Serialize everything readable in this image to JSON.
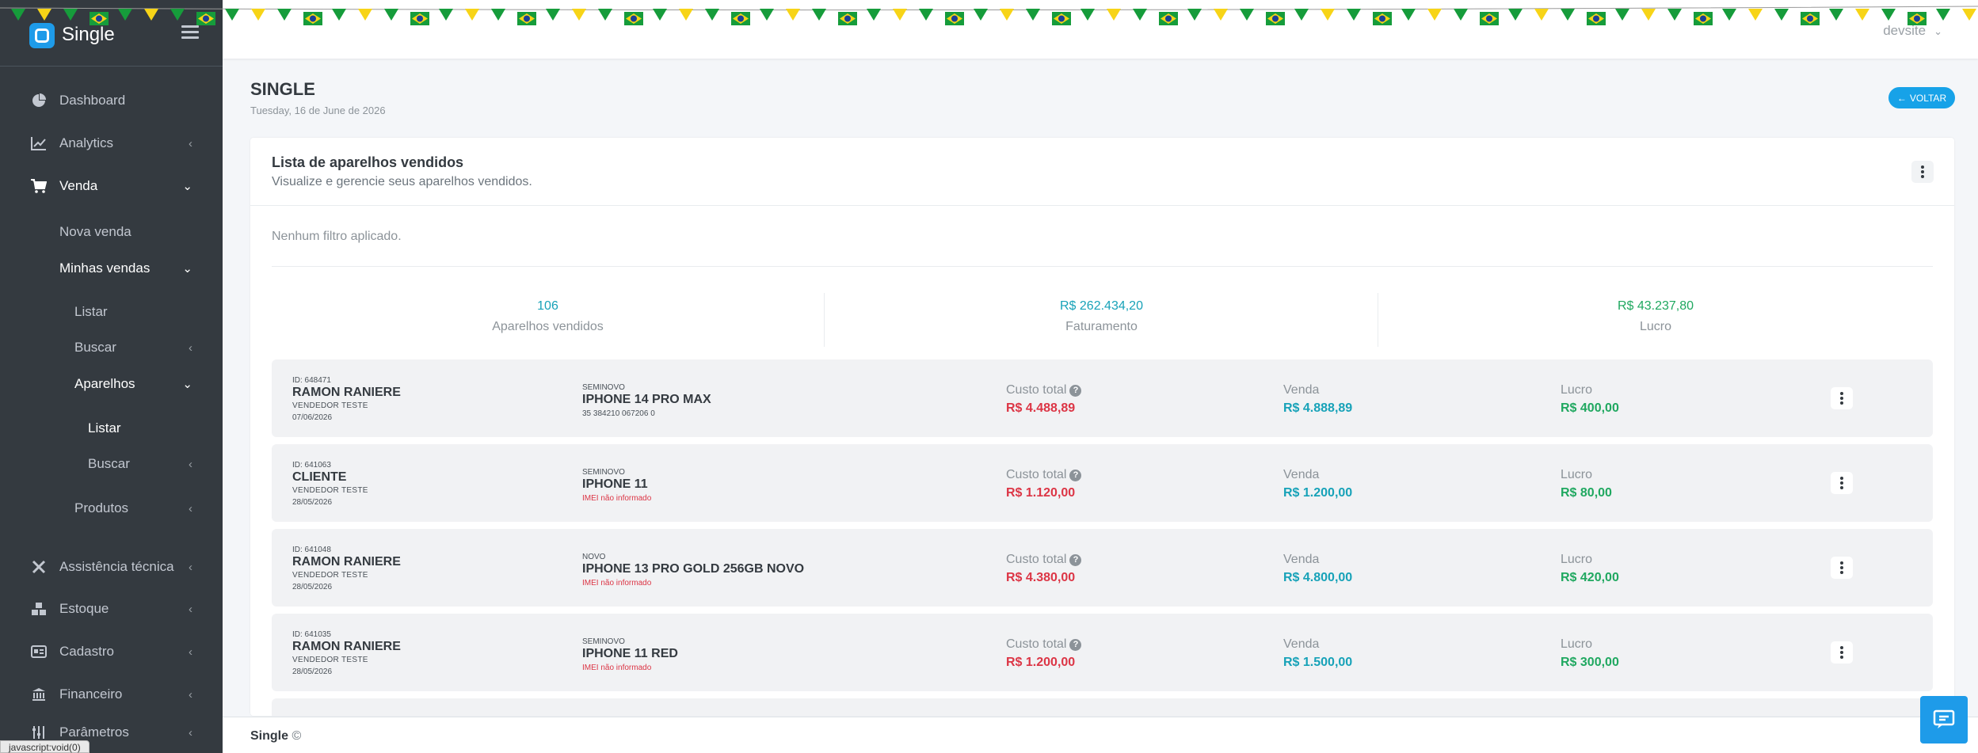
{
  "brand": {
    "name": "Single"
  },
  "topbar": {
    "user": "devsite"
  },
  "sidebar": {
    "items": [
      {
        "label": "Dashboard"
      },
      {
        "label": "Analytics"
      },
      {
        "label": "Venda"
      },
      {
        "label": "Nova venda"
      },
      {
        "label": "Minhas vendas"
      },
      {
        "label": "Listar"
      },
      {
        "label": "Buscar"
      },
      {
        "label": "Aparelhos"
      },
      {
        "label": "Listar"
      },
      {
        "label": "Buscar"
      },
      {
        "label": "Produtos"
      },
      {
        "label": "Assistência técnica"
      },
      {
        "label": "Estoque"
      },
      {
        "label": "Cadastro"
      },
      {
        "label": "Financeiro"
      },
      {
        "label": "Parâmetros"
      }
    ]
  },
  "status_bar": "javascript:void(0)",
  "page": {
    "title": "SINGLE",
    "date": "Tuesday, 16 de June de 2026",
    "back_label": "VOLTAR"
  },
  "card": {
    "title": "Lista de aparelhos vendidos",
    "subtitle": "Visualize e gerencie seus aparelhos vendidos.",
    "filters": "Nenhum filtro aplicado."
  },
  "stats": [
    {
      "value": "106",
      "label": "Aparelhos vendidos"
    },
    {
      "value": "R$ 262.434,20",
      "label": "Faturamento"
    },
    {
      "value": "R$ 43.237,80",
      "label": "Lucro"
    }
  ],
  "labels": {
    "cost": "Custo total",
    "sale": "Venda",
    "profit": "Lucro",
    "help": "?"
  },
  "rows": [
    {
      "id": "ID: 648471",
      "customer": "RAMON RANIERE",
      "seller": "VENDEDOR TESTE",
      "date": "07/06/2026",
      "condition": "SEMINOVO",
      "model": "IPHONE 14 PRO MAX",
      "imei": "35 384210 067206 0",
      "cost": "R$ 4.488,89",
      "sale": "R$ 4.888,89",
      "profit": "R$ 400,00"
    },
    {
      "id": "ID: 641063",
      "customer": "CLIENTE",
      "seller": "VENDEDOR TESTE",
      "date": "28/05/2026",
      "condition": "SEMINOVO",
      "model": "IPHONE 11",
      "imei": "IMEI não informado",
      "cost": "R$ 1.120,00",
      "sale": "R$ 1.200,00",
      "profit": "R$ 80,00"
    },
    {
      "id": "ID: 641048",
      "customer": "RAMON RANIERE",
      "seller": "VENDEDOR TESTE",
      "date": "28/05/2026",
      "condition": "NOVO",
      "model": "IPHONE 13 PRO GOLD 256GB NOVO",
      "imei": "IMEI não informado",
      "cost": "R$ 4.380,00",
      "sale": "R$ 4.800,00",
      "profit": "R$ 420,00"
    },
    {
      "id": "ID: 641035",
      "customer": "RAMON RANIERE",
      "seller": "VENDEDOR TESTE",
      "date": "28/05/2026",
      "condition": "SEMINOVO",
      "model": "IPHONE 11 RED",
      "imei": "IMEI não informado",
      "cost": "R$ 1.200,00",
      "sale": "R$ 1.500,00",
      "profit": "R$ 300,00"
    }
  ],
  "footer": {
    "brand": "Single",
    "copyright": "©"
  },
  "colors": {
    "sidebar": "#343a40",
    "accent": "#17a2e8",
    "cost": "#dc3545",
    "sale": "#17a2b8",
    "profit": "#20a860"
  }
}
